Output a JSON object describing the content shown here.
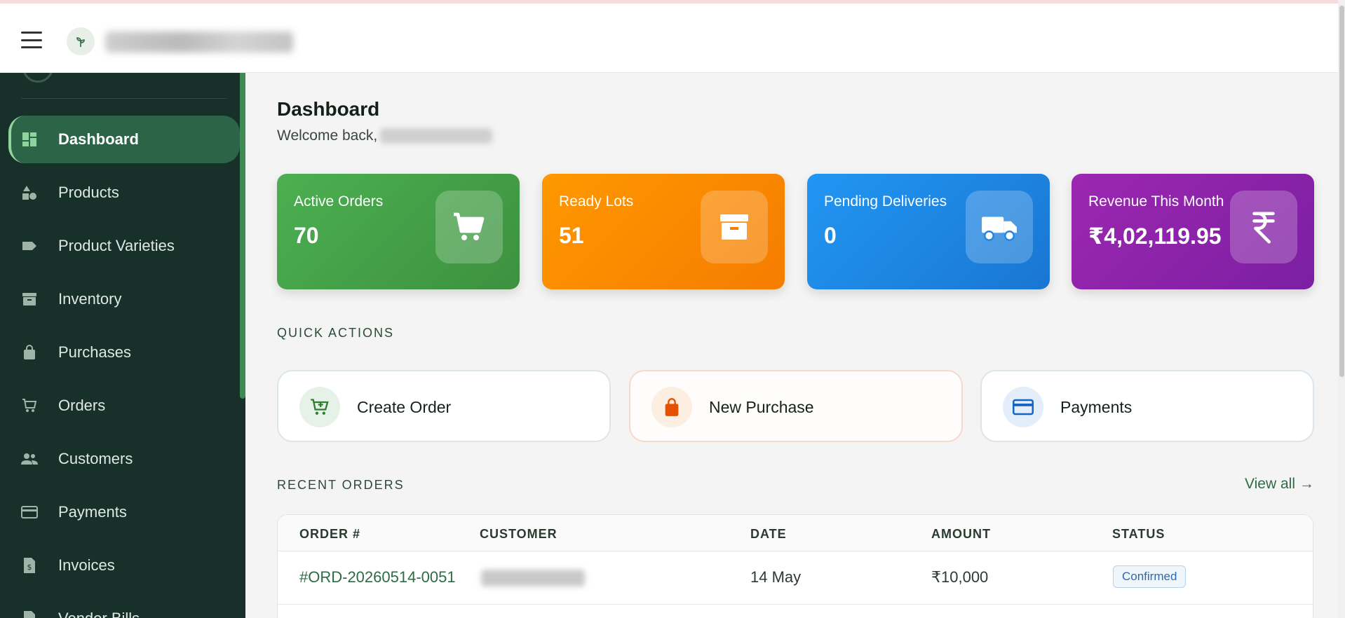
{
  "nav": [
    {
      "label": "Dashboard",
      "icon": "dashboard-icon",
      "active": true
    },
    {
      "label": "Products",
      "icon": "category-icon"
    },
    {
      "label": "Product Varieties",
      "icon": "tag-icon"
    },
    {
      "label": "Inventory",
      "icon": "archive-icon"
    },
    {
      "label": "Purchases",
      "icon": "shopping-bag-icon"
    },
    {
      "label": "Orders",
      "icon": "cart-icon"
    },
    {
      "label": "Customers",
      "icon": "people-icon"
    },
    {
      "label": "Payments",
      "icon": "credit-card-icon"
    },
    {
      "label": "Invoices",
      "icon": "invoice-icon"
    },
    {
      "label": "Vendor Bills",
      "icon": "document-icon"
    }
  ],
  "header": {
    "title": "Dashboard",
    "welcome": "Welcome back,"
  },
  "stats": [
    {
      "label": "Active Orders",
      "value": "70",
      "icon": "cart-icon",
      "color": "#43a047"
    },
    {
      "label": "Ready Lots",
      "value": "51",
      "icon": "archive-icon",
      "color": "#fb8c00"
    },
    {
      "label": "Pending Deliveries",
      "value": "0",
      "icon": "truck-icon",
      "color": "#1e88e5"
    },
    {
      "label": "Revenue This Month",
      "value": "₹4,02,119.95",
      "icon": "rupee-icon",
      "color": "#8e24aa"
    }
  ],
  "quick_actions": {
    "heading": "QUICK ACTIONS",
    "items": [
      {
        "label": "Create Order",
        "icon": "add-cart-icon",
        "color": "#2e7d32"
      },
      {
        "label": "New Purchase",
        "icon": "shopping-bag-icon",
        "color": "#e65100"
      },
      {
        "label": "Payments",
        "icon": "credit-card-icon",
        "color": "#1565c0"
      }
    ]
  },
  "recent_orders": {
    "heading": "RECENT ORDERS",
    "view_all": "View all →",
    "columns": [
      "ORDER #",
      "CUSTOMER",
      "DATE",
      "AMOUNT",
      "STATUS"
    ],
    "rows": [
      {
        "order": "#ORD-20260514-0051",
        "date": "14 May",
        "amount": "₹10,000",
        "status": "Confirmed"
      }
    ]
  }
}
